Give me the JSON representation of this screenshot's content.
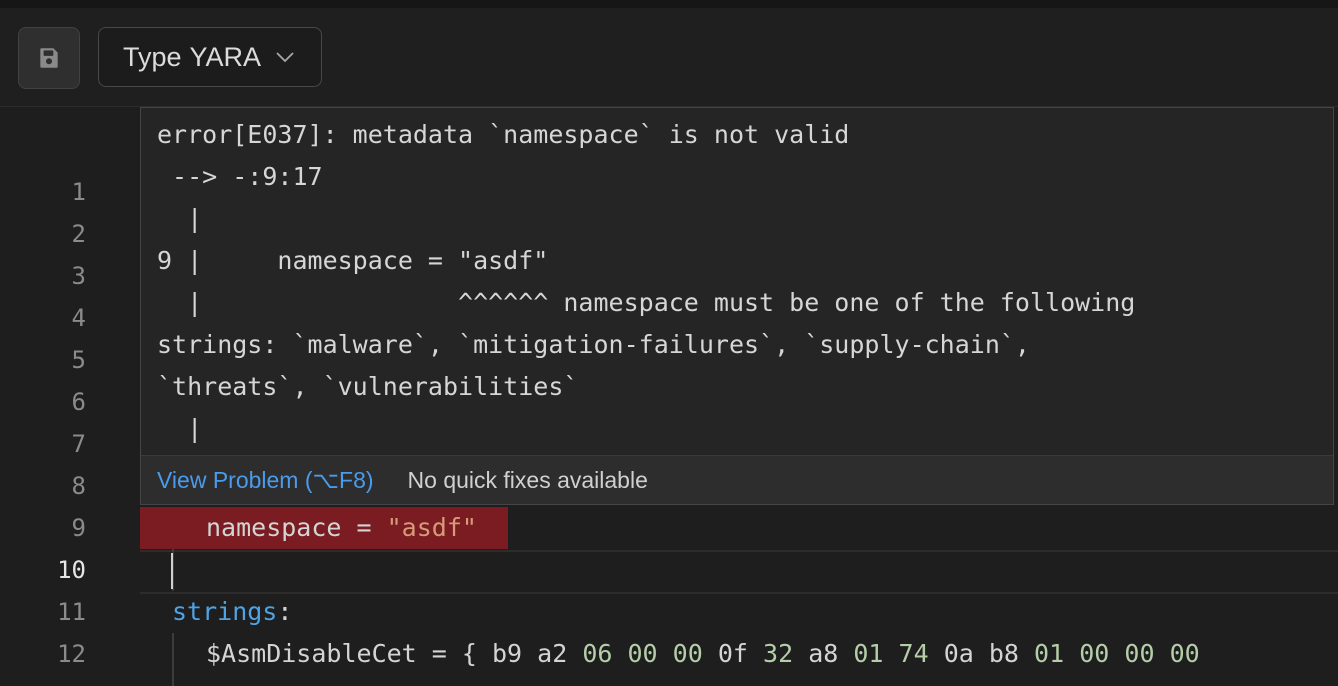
{
  "toolbar": {
    "save_icon": "floppy-disk-icon",
    "type_label": "Type",
    "type_value": "YARA",
    "dropdown_icon": "chevron-down-icon"
  },
  "editor": {
    "line_numbers": [
      "1",
      "2",
      "3",
      "4",
      "5",
      "6",
      "7",
      "8",
      "9",
      "10",
      "11",
      "12"
    ],
    "active_line": "10",
    "lines": {
      "l9_key": "namespace",
      "l9_op": " = ",
      "l9_val": "\"asdf\"",
      "l11_kw": "strings",
      "l11_colon": ":",
      "l12_var": "$AsmDisableCet",
      "l12_op": " = { ",
      "l12_bytes": [
        "b9",
        "a2",
        "06",
        "00",
        "00",
        "0f",
        "32",
        "a8",
        "01",
        "74",
        "0a",
        "b8",
        "01",
        "00",
        "00",
        "00"
      ]
    }
  },
  "hover": {
    "message": "error[E037]: metadata `namespace` is not valid\n --> -:9:17\n  |\n9 |     namespace = \"asdf\"\n  |                 ^^^^^^ namespace must be one of the following\nstrings: `malware`, `mitigation-failures`, `supply-chain`,\n`threats`, `vulnerabilities`\n  |",
    "view_problem": "View Problem (⌥F8)",
    "no_quick_fixes": "No quick fixes available"
  },
  "colors": {
    "error_highlight": "#7a1c21",
    "keyword": "#4fa3e3",
    "string": "#d69b7a",
    "numeric": "#b5cea8",
    "link": "#4a9bea"
  }
}
